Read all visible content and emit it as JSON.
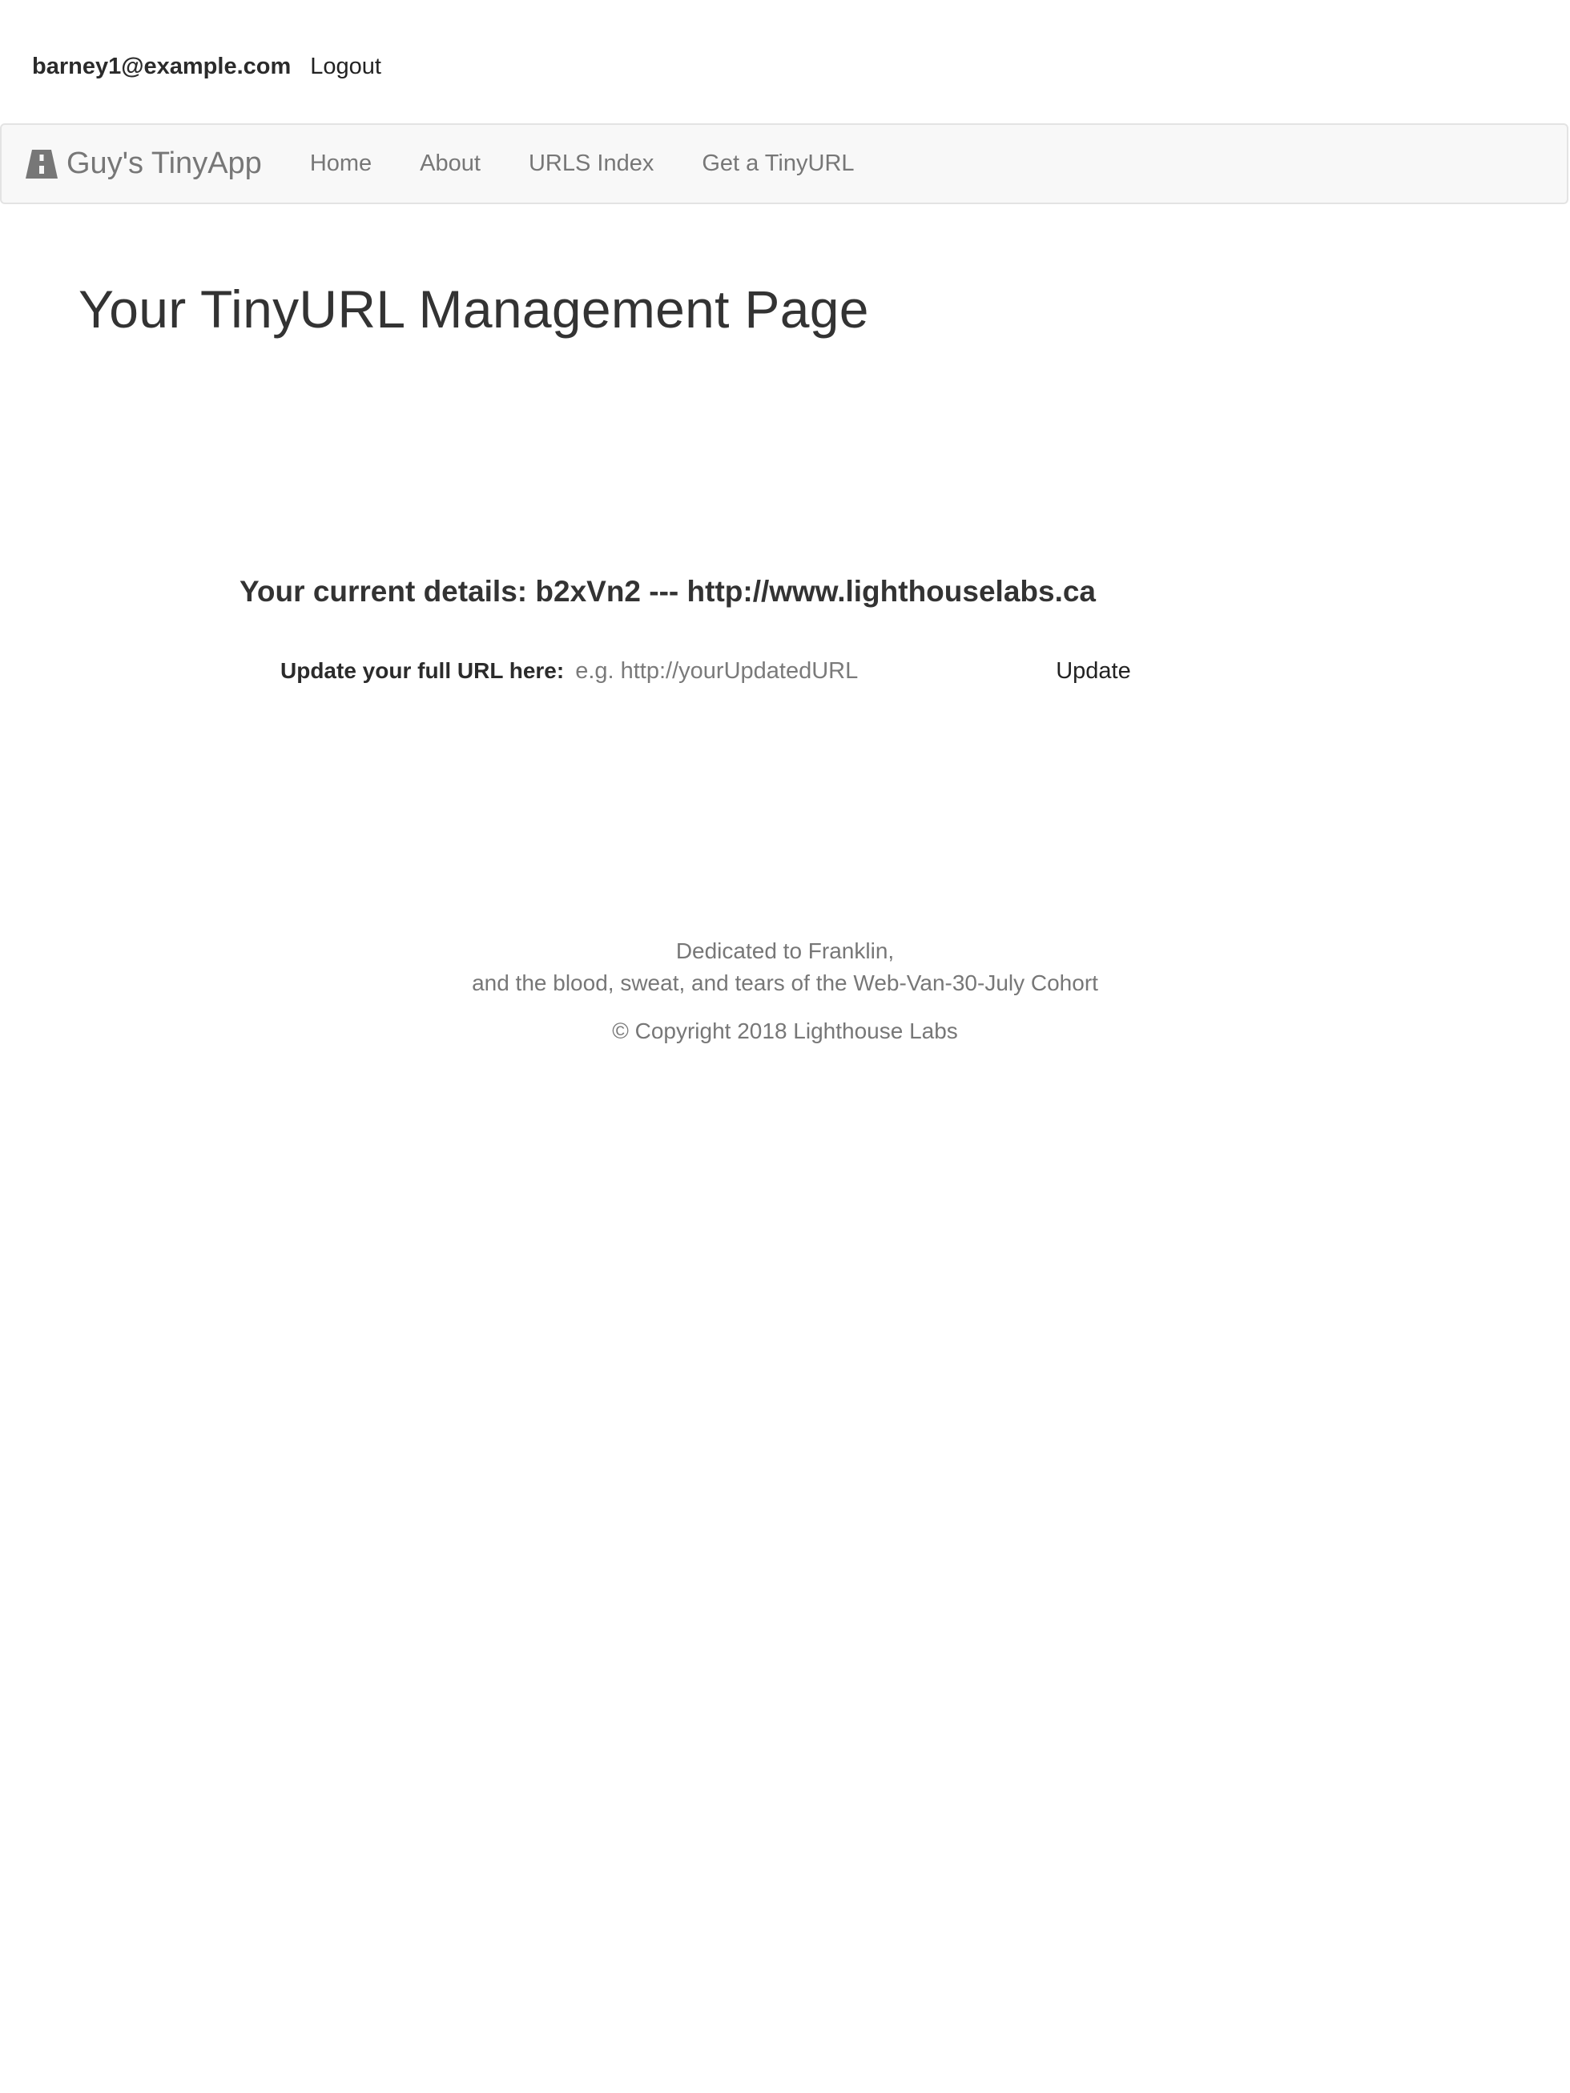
{
  "user": {
    "email": "barney1@example.com",
    "logout_label": "Logout"
  },
  "navbar": {
    "brand_icon": "road-icon",
    "brand_label": "Guy's TinyApp",
    "items": [
      {
        "label": "Home"
      },
      {
        "label": "About"
      },
      {
        "label": "URLS Index"
      },
      {
        "label": "Get a TinyURL"
      }
    ]
  },
  "main": {
    "title": "Your TinyURL Management Page",
    "details": "Your current details: b2xVn2 --- http://www.lighthouselabs.ca",
    "update_label": "Update your full URL here:",
    "update_input_value": "",
    "update_input_placeholder": "e.g. http://yourUpdatedURL",
    "update_button_label": "Update"
  },
  "footer": {
    "dedication_line1": "Dedicated to Franklin,",
    "dedication_line2": "and the blood, sweat, and tears of the Web-Van-30-July Cohort",
    "copyright": "© Copyright 2018 Lighthouse Labs"
  },
  "colors": {
    "navbar_bg": "#f8f8f8",
    "nav_text": "#777777",
    "heading_text": "#333333"
  }
}
